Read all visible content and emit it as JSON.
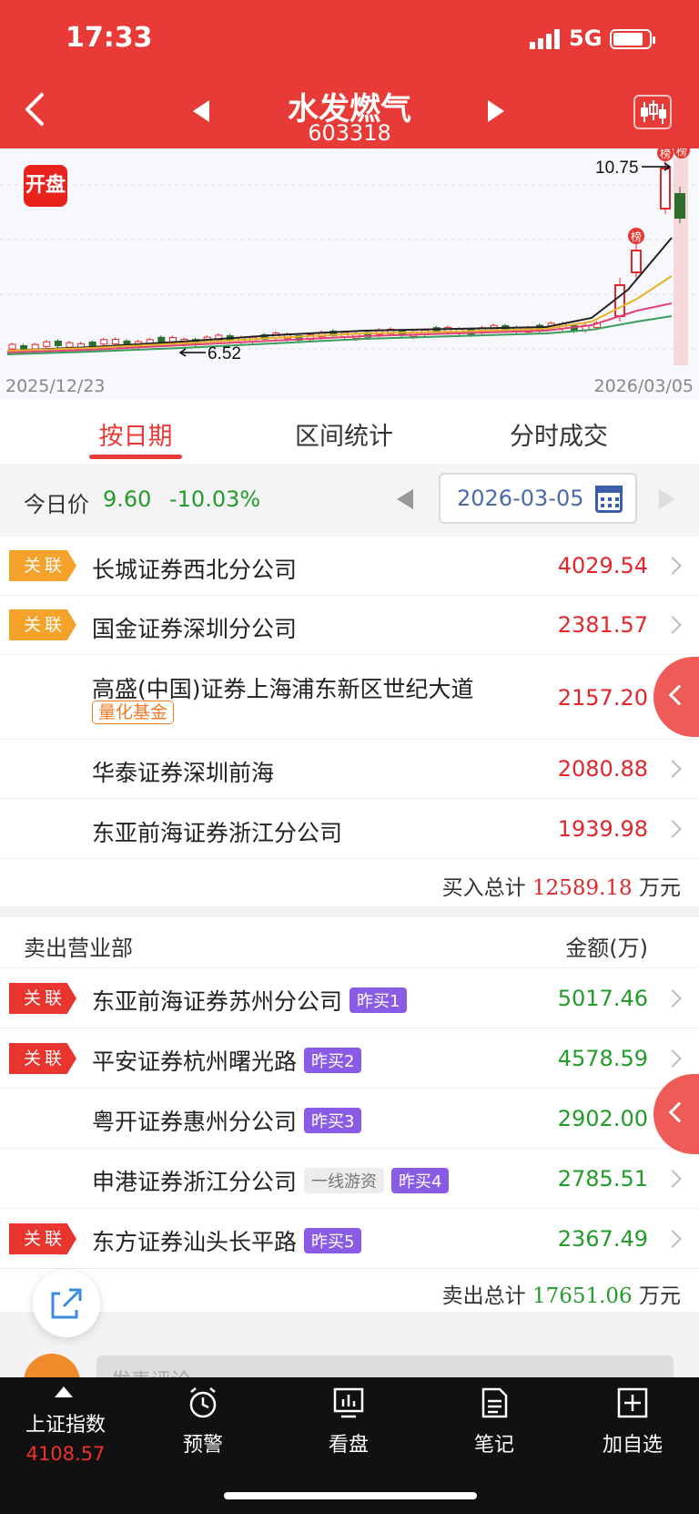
{
  "status": {
    "time": "17:33",
    "network": "5G"
  },
  "header": {
    "stock_name": "水发燃气",
    "stock_code": "603318"
  },
  "chart": {
    "open_badge": "开盘",
    "date_start": "2025/12/23",
    "date_end": "2026/03/05",
    "high_label": "10.75",
    "low_label": "6.52",
    "rank_marker": "榜"
  },
  "chart_data": {
    "type": "candlestick",
    "x_range": [
      "2025/12/23",
      "2026/03/05"
    ],
    "annotations": [
      {
        "label": "10.75",
        "kind": "high"
      },
      {
        "label": "6.52",
        "kind": "low"
      }
    ]
  },
  "tabs": [
    "按日期",
    "区间统计",
    "分时成交"
  ],
  "price_bar": {
    "label": "今日价",
    "price": "9.60",
    "change": "-10.03%",
    "date": "2026-03-05"
  },
  "buy_rows": [
    {
      "tag": "关联",
      "name": "长城证券西北分公司",
      "amount": "4029.54"
    },
    {
      "tag": "关联",
      "name": "国金证券深圳分公司",
      "amount": "2381.57"
    },
    {
      "tag": "",
      "name": "高盛(中国)证券上海浦东新区世纪大道",
      "badge": "量化基金",
      "amount": "2157.20"
    },
    {
      "tag": "",
      "name": "华泰证券深圳前海",
      "amount": "2080.88"
    },
    {
      "tag": "",
      "name": "东亚前海证券浙江分公司",
      "amount": "1939.98"
    }
  ],
  "buy_total": {
    "label": "买入总计",
    "value": "12589.18",
    "unit": "万元"
  },
  "sell_header": {
    "title": "卖出营业部",
    "amount_col": "金额(万)"
  },
  "sell_rows": [
    {
      "tag": "关联",
      "name": "东亚前海证券苏州分公司",
      "badge": "昨买1",
      "amount": "5017.46"
    },
    {
      "tag": "关联",
      "name": "平安证券杭州曙光路",
      "badge": "昨买2",
      "amount": "4578.59"
    },
    {
      "tag": "",
      "name": "粤开证券惠州分公司",
      "badge": "昨买3",
      "amount": "2902.00"
    },
    {
      "tag": "",
      "name": "申港证券浙江分公司",
      "gray_badge": "一线游资",
      "badge": "昨买4",
      "amount": "2785.51"
    },
    {
      "tag": "关联",
      "name": "东方证券汕头长平路",
      "badge": "昨买5",
      "amount": "2367.49"
    }
  ],
  "sell_total": {
    "label": "卖出总计",
    "value": "17651.06",
    "unit": "万元"
  },
  "comment": {
    "placeholder": "发表评论"
  },
  "bottom_nav": {
    "index_name": "上证指数",
    "index_value": "4108.57",
    "items": [
      "预警",
      "看盘",
      "笔记",
      "加自选"
    ]
  },
  "colors": {
    "brand_red": "#e83a36",
    "up_red": "#e2262b",
    "down_green": "#239b2b",
    "tag_orange": "#f5a22a",
    "badge_purple": "#8a5ce6"
  }
}
